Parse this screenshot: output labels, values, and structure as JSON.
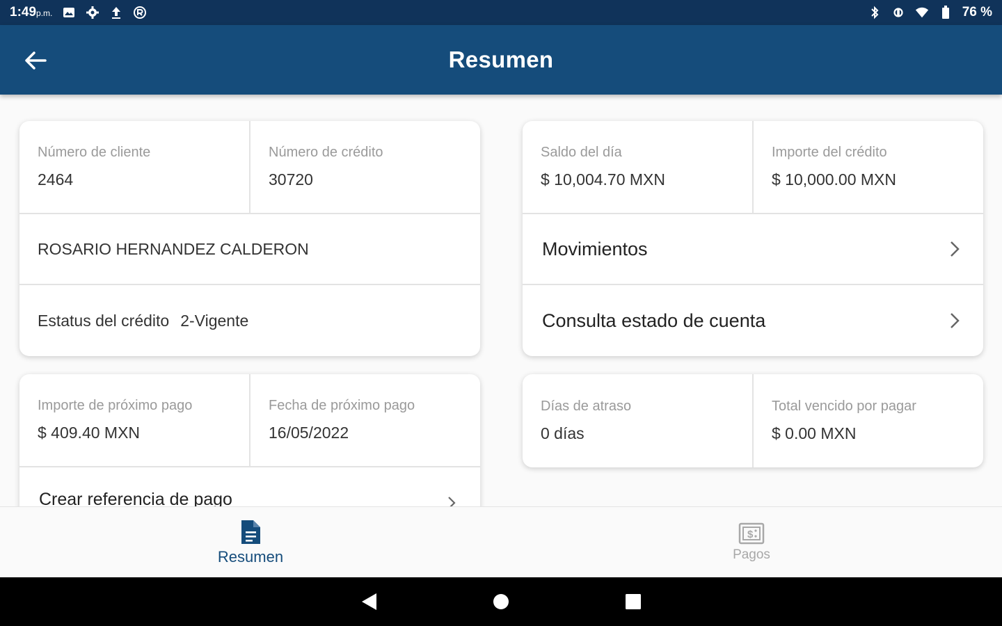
{
  "status_bar": {
    "time": "1:49",
    "meridiem": "p.m.",
    "battery": "76 %"
  },
  "app_bar": {
    "title": "Resumen"
  },
  "client_card": {
    "client_number_label": "Número de cliente",
    "client_number": "2464",
    "credit_number_label": "Número de crédito",
    "credit_number": "30720",
    "client_name": "ROSARIO HERNANDEZ CALDERON",
    "credit_status_label": "Estatus del crédito",
    "credit_status": "2-Vigente"
  },
  "balance_card": {
    "day_balance_label": "Saldo del día",
    "day_balance": "$ 10,004.70 MXN",
    "credit_amount_label": "Importe del crédito",
    "credit_amount": "$ 10,000.00 MXN",
    "movements_label": "Movimientos",
    "statement_label": "Consulta estado de cuenta"
  },
  "payment_card": {
    "next_amount_label": "Importe de próximo pago",
    "next_amount": "$ 409.40 MXN",
    "next_date_label": "Fecha de próximo pago",
    "next_date": "16/05/2022",
    "create_reference_label": "Crear referencia de pago"
  },
  "arrears_card": {
    "days_late_label": "Días de atraso",
    "days_late": "0 días",
    "total_due_label": "Total vencido por pagar",
    "total_due": "$ 0.00 MXN"
  },
  "bottom_nav": {
    "items": [
      {
        "label": "Resumen",
        "icon": "document-icon",
        "active": true
      },
      {
        "label": "Pagos",
        "icon": "payment-icon",
        "active": false
      }
    ]
  },
  "colors": {
    "status_bar": "#10335a",
    "app_bar": "#154c7b",
    "active_tab": "#154c7b",
    "inactive_tab": "#a8a8a8"
  }
}
